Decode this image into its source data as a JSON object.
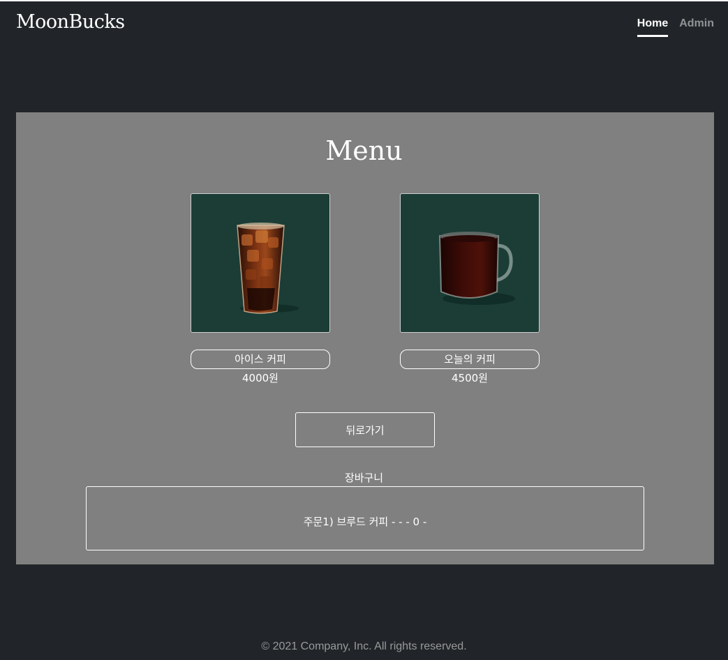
{
  "header": {
    "brand": "MoonBucks",
    "nav": [
      {
        "label": "Home",
        "active": true
      },
      {
        "label": "Admin",
        "active": false
      }
    ]
  },
  "menu": {
    "title": "Menu",
    "items": [
      {
        "name": "아이스 커피",
        "price": "4000원",
        "image": "iced-coffee-image"
      },
      {
        "name": "오늘의 커피",
        "price": "4500원",
        "image": "brewed-coffee-mug-image"
      }
    ],
    "back_label": "뒤로가기"
  },
  "cart": {
    "title": "장바구니",
    "lines": [
      "주문1) 브루드 커피 - - - 0 -"
    ]
  },
  "footer": {
    "text": "© 2021 Company, Inc. All rights reserved."
  },
  "colors": {
    "background": "#212529",
    "panel": "#808080",
    "product_bg": "#1b3d36",
    "text": "#ffffff"
  }
}
